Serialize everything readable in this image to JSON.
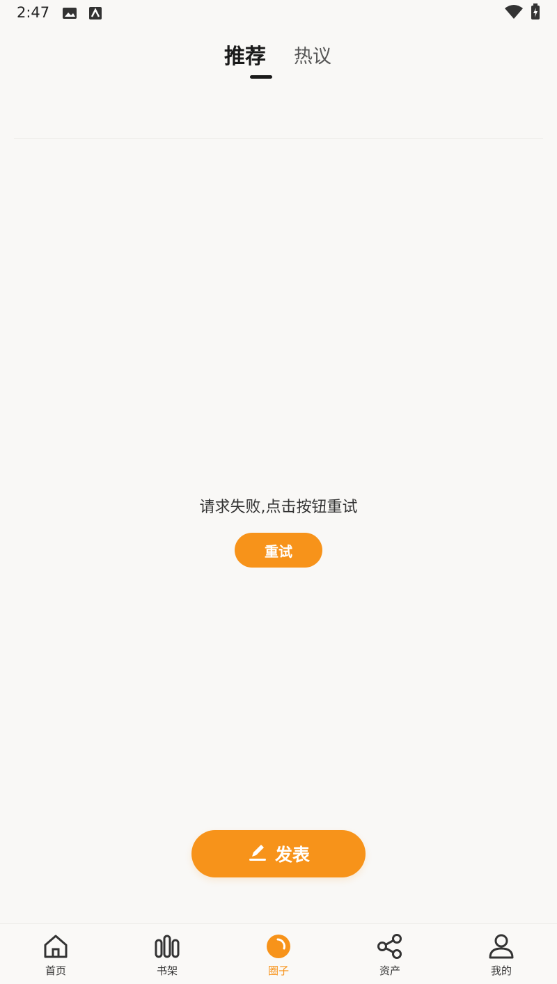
{
  "status_bar": {
    "time": "2:47",
    "icons": [
      "image-icon",
      "app-icon",
      "wifi-icon",
      "battery-icon"
    ]
  },
  "tabs": [
    {
      "label": "推荐",
      "active": true
    },
    {
      "label": "热议",
      "active": false
    }
  ],
  "error": {
    "message": "请求失败,点击按钮重试",
    "retry_label": "重试"
  },
  "publish": {
    "label": "发表",
    "icon": "pencil-icon"
  },
  "bottom_nav": {
    "items": [
      {
        "label": "首页",
        "icon": "home-icon",
        "active": false
      },
      {
        "label": "书架",
        "icon": "bookshelf-icon",
        "active": false
      },
      {
        "label": "圈子",
        "icon": "circle-icon",
        "active": true
      },
      {
        "label": "资产",
        "icon": "share-icon",
        "active": false
      },
      {
        "label": "我的",
        "icon": "profile-icon",
        "active": false
      }
    ]
  },
  "colors": {
    "accent": "#f7931a",
    "background": "#f9f8f6",
    "text": "#222222"
  }
}
